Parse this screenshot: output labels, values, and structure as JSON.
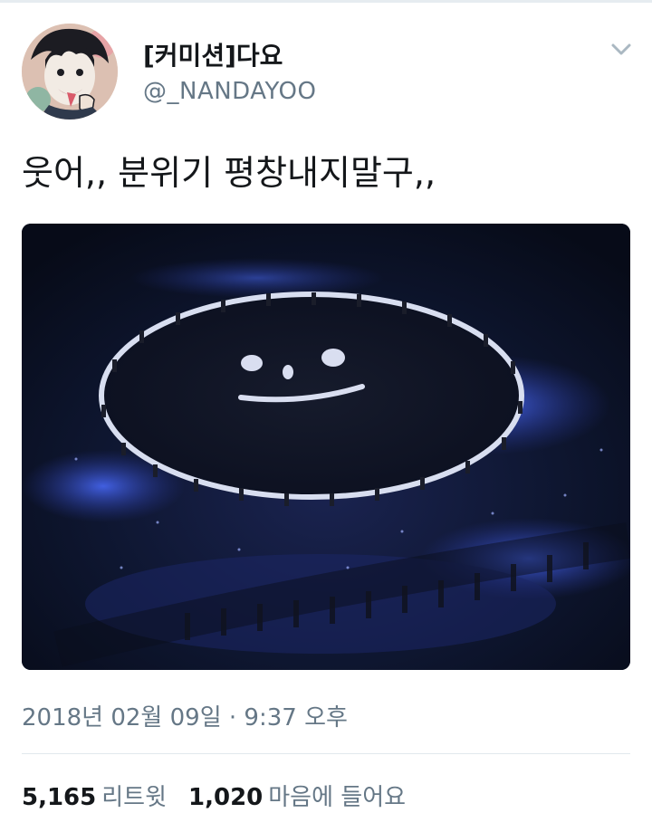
{
  "tweet": {
    "display_name": "[커미션]다요",
    "handle": "@_NANDAYOO",
    "text": "웃어,, 분위기 평창내지말구,,",
    "timestamp": "2018년 02월 09일 · 9:37 오후",
    "retweets": {
      "count": "5,165",
      "label": "리트윗"
    },
    "likes": {
      "count": "1,020",
      "label": "마음에 들어요"
    }
  },
  "icons": {
    "menu": "chevron-down-icon"
  },
  "colors": {
    "text_primary": "#14171a",
    "text_secondary": "#657786",
    "divider": "#e1e8ed",
    "chevron": "#aab8c2",
    "photo_glow": "#3a4fd6"
  }
}
